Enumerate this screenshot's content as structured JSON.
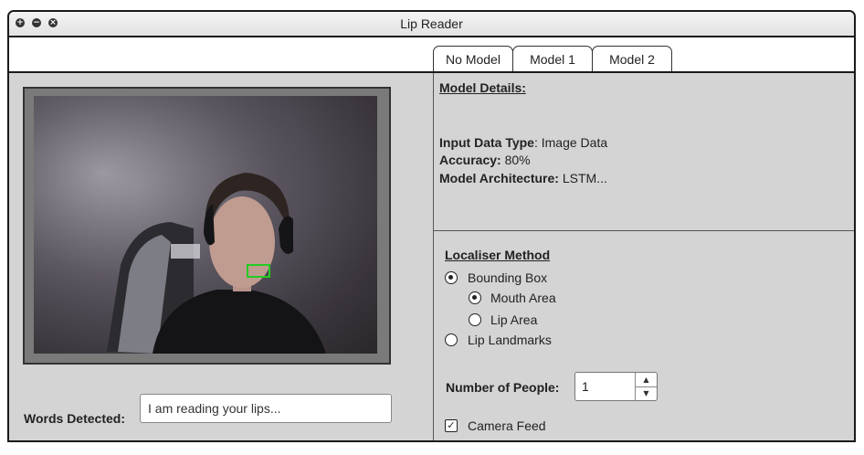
{
  "window": {
    "title": "Lip Reader",
    "controls": [
      "add-icon",
      "minimize-icon",
      "close-icon"
    ]
  },
  "tabs": [
    {
      "label": "No Model",
      "active": true
    },
    {
      "label": "Model 1",
      "active": false
    },
    {
      "label": "Model 2",
      "active": false
    }
  ],
  "camera": {
    "detection": "mouth-bounding-box",
    "box_color": "#22cc22"
  },
  "words": {
    "label": "Words Detected:",
    "value": "I am reading your lips..."
  },
  "details": {
    "heading": "Model Details:",
    "input_type_label": "Input Data Type",
    "input_type_value": ": Image Data",
    "accuracy_label": "Accuracy:",
    "accuracy_value": " 80%",
    "architecture_label": "Model Architecture:",
    "architecture_value": " LSTM..."
  },
  "localiser": {
    "heading": "Localiser Method",
    "options": [
      {
        "label": "Bounding Box",
        "checked": true
      },
      {
        "label": "Mouth Area",
        "checked": true
      },
      {
        "label": "Lip Area",
        "checked": false
      },
      {
        "label": "Lip Landmarks",
        "checked": false
      }
    ]
  },
  "people": {
    "label": "Number of People:",
    "value": "1"
  },
  "camera_feed": {
    "label": "Camera Feed",
    "checked": true,
    "check_glyph": "✓"
  }
}
